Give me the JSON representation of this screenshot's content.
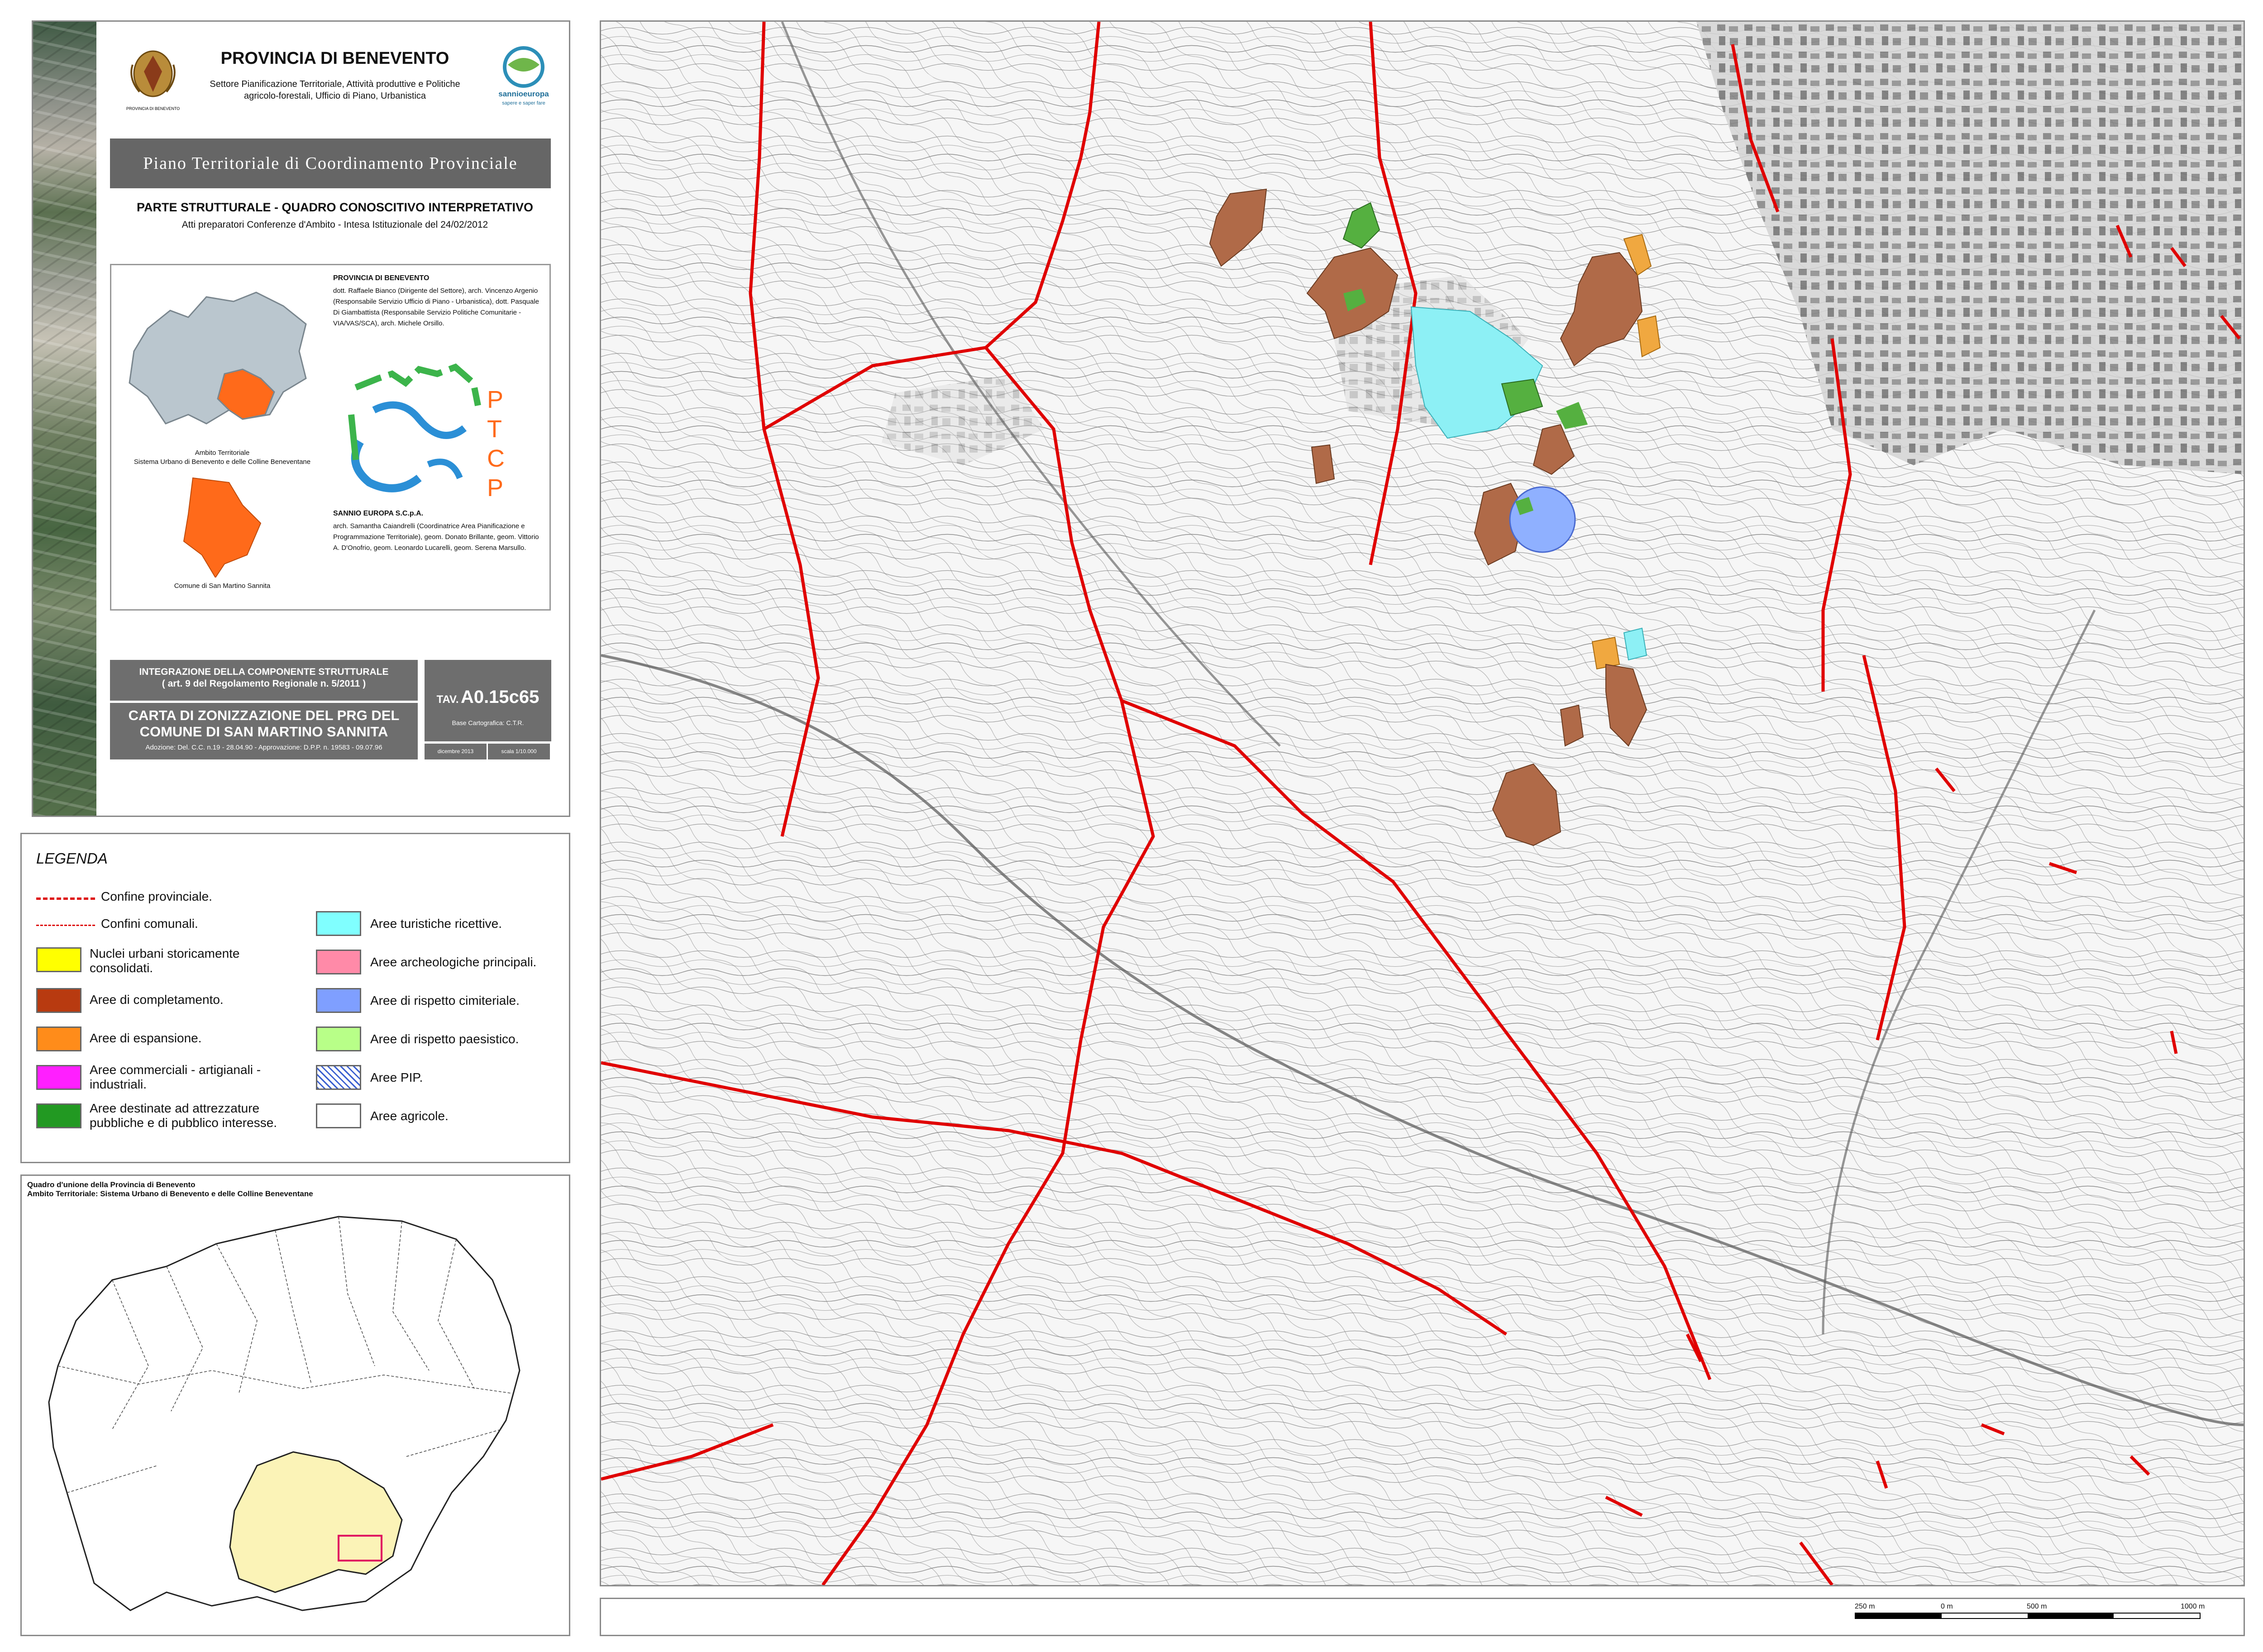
{
  "title_block": {
    "province_name": "PROVINCIA DI BENEVENTO",
    "logo_caption": "PROVINCIA DI BENEVENTO",
    "sector": "Settore Pianificazione Territoriale, Attività produttive e Politiche agricolo-forestali, Ufficio di Piano, Urbanistica",
    "sannio_logo_text": "sannioeuropa",
    "sannio_logo_sub": "sapere e saper fare",
    "plan_title": "Piano Territoriale di Coordinamento Provinciale",
    "section_title": "PARTE STRUTTURALE - QUADRO CONOSCITIVO INTERPRETATIVO",
    "section_subtitle": "Atti preparatori Conferenze d'Ambito - Intesa Istituzionale del 24/02/2012",
    "ambito_caption": "Ambito Territoriale\nSistema Urbano di Benevento e delle Colline Beneventane",
    "comune_caption": "Comune di San Martino Sannita",
    "province_staff_head": "PROVINCIA DI BENEVENTO",
    "province_staff": "dott. Raffaele Bianco (Dirigente del Settore), arch. Vincenzo Argenio (Responsabile Servizio Ufficio di Piano - Urbanistica), dott. Pasquale Di Giambattista (Responsabile Servizio Politiche Comunitarie - VIA/VAS/SCA), arch. Michele Orsillo.",
    "ptcp_letters": [
      "P",
      "T",
      "C",
      "P"
    ],
    "sannio_head": "SANNIO EUROPA S.C.p.A.",
    "sannio_staff": "arch. Samantha Caiandrelli (Coordinatrice Area Pianificazione e Programmazione Territoriale), geom. Donato Brillante, geom. Vittorio A. D'Onofrio, geom. Leonardo Lucarelli, geom. Serena Marsullo.",
    "integration_line1": "INTEGRAZIONE DELLA COMPONENTE STRUTTURALE",
    "integration_line2": "( art. 9 del Regolamento Regionale n. 5/2011 )",
    "map_title": "CARTA DI ZONIZZAZIONE DEL PRG DEL COMUNE DI SAN MARTINO SANNITA",
    "adoption": "Adozione: Del. C.C. n.19 - 28.04.90 - Approvazione: D.P.P. n. 19583 - 09.07.96",
    "tav_label": "TAV.",
    "tav_code": "A0.15c65",
    "base": "Base Cartografica: C.T.R.",
    "date": "dicembre 2013",
    "scale": "scala 1/10.000"
  },
  "legend": {
    "title": "LEGENDA",
    "lines": [
      {
        "label": "Confine provinciale.",
        "color": "#d40000"
      },
      {
        "label": "Confini comunali.",
        "color": "#d40000"
      }
    ],
    "left_items": [
      {
        "label": "Nuclei urbani storicamente consolidati.",
        "color": "#ffff00"
      },
      {
        "label": "Aree di completamento.",
        "color": "#b83a10"
      },
      {
        "label": "Aree di espansione.",
        "color": "#ff8c1a"
      },
      {
        "label": "Aree commerciali - artigianali - industriali.",
        "color": "#ff1fff"
      },
      {
        "label": "Aree destinate ad attrezzature pubbliche e di pubblico interesse.",
        "color": "#229922"
      }
    ],
    "right_items": [
      {
        "label": "Aree turistiche ricettive.",
        "color": "#80ffff"
      },
      {
        "label": "Aree archeologiche principali.",
        "color": "#ff8aa8"
      },
      {
        "label": "Aree di rispetto cimiteriale.",
        "color": "#7f9fff"
      },
      {
        "label": "Aree di rispetto paesistico.",
        "color": "#b8ff88"
      },
      {
        "label": "Aree PIP.",
        "color": "hatch"
      },
      {
        "label": "Aree agricole.",
        "color": "#ffffff"
      }
    ]
  },
  "index_map": {
    "title_line1": "Quadro d'unione della Provincia di Benevento",
    "title_line2": "Ambito Territoriale: Sistema Urbano di Benevento e delle Colline Beneventane"
  },
  "scale_bar": {
    "labels": [
      "250 m",
      "0 m",
      "500 m",
      "1000 m"
    ]
  },
  "colors": {
    "completamento": "#b06a48",
    "espansione": "#f0a840",
    "attrezzature": "#55b040",
    "turistiche": "#8df0f5",
    "cimiteriale": "#8fb0ff",
    "boundary": "#e00000"
  }
}
